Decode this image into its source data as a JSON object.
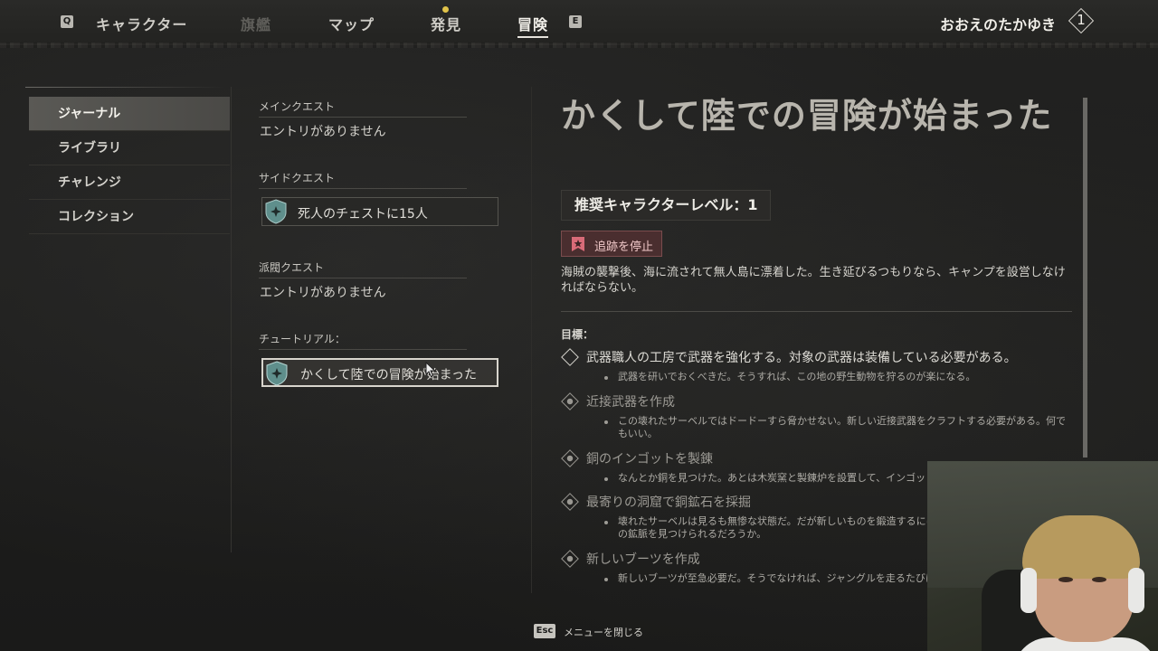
{
  "top_nav": {
    "prev_key": "Q",
    "next_key": "E",
    "tabs": [
      {
        "label": "キャラクター",
        "state": "normal"
      },
      {
        "label": "旗艦",
        "state": "disabled"
      },
      {
        "label": "マップ",
        "state": "normal"
      },
      {
        "label": "発見",
        "state": "normal",
        "notification": true
      },
      {
        "label": "冒険",
        "state": "active"
      }
    ],
    "player_name": "おおえのたかゆき",
    "player_level": "1"
  },
  "sidebar": {
    "items": [
      {
        "label": "ジャーナル",
        "active": true
      },
      {
        "label": "ライブラリ",
        "active": false
      },
      {
        "label": "チャレンジ",
        "active": false
      },
      {
        "label": "コレクション",
        "active": false
      }
    ]
  },
  "quests": {
    "main": {
      "heading": "メインクエスト",
      "empty": "エントリがありません"
    },
    "side": {
      "heading": "サイドクエスト",
      "entries": [
        "死人のチェストに15人"
      ]
    },
    "faction": {
      "heading": "派閥クエスト",
      "empty": "エントリがありません"
    },
    "tutorial": {
      "heading": "チュートリアル：",
      "entries": [
        "かくして陸での冒険が始まった"
      ]
    }
  },
  "detail": {
    "title": "かくして陸での冒険が始まった",
    "recommended_level": "推奨キャラクターレベル：1",
    "stop_tracking": "追跡を停止",
    "description": "海賊の襲撃後、海に流されて無人島に漂着した。生き延びるつもりなら、キャンプを設営しなければならない。",
    "objectives_heading": "目標：",
    "objectives": [
      {
        "title": "武器職人の工房で武器を強化する。対象の武器は装備している必要がある。",
        "note": "武器を研いでおくべきだ。そうすれば、この地の野生動物を狩るのが楽になる。",
        "done": false
      },
      {
        "title": "近接武器を作成",
        "note": "この壊れたサーベルではドードーすら脅かせない。新しい近接武器をクラフトする必要がある。何でもいい。",
        "done": true
      },
      {
        "title": "銅のインゴットを製錬",
        "note": "なんとか銅を見つけた。あとは木炭窯と製錬炉を設置して、インゴットにする必要がある。",
        "done": true
      },
      {
        "title": "最寄りの洞窟で銅鉱石を採掘",
        "note": "壊れたサーベルは見るも無惨な状態だ。だが新しいものを鍛造するには、金属が必要になる。この島の鉱脈を見つけられるだろうか。",
        "done": true
      },
      {
        "title": "新しいブーツを作成",
        "note": "新しいブーツが至急必要だ。そうでなければ、ジャングルを走るたびに足にマメができ続ける。",
        "done": true
      }
    ]
  },
  "footer": {
    "close_key": "Esc",
    "close_label": "メニューを閉じる"
  },
  "colors": {
    "background": "#1b1b1a",
    "active_tab": "#f2f0ea",
    "stop_tracking_bg": "#4a2e2f",
    "notification_dot": "#e1c34a"
  }
}
